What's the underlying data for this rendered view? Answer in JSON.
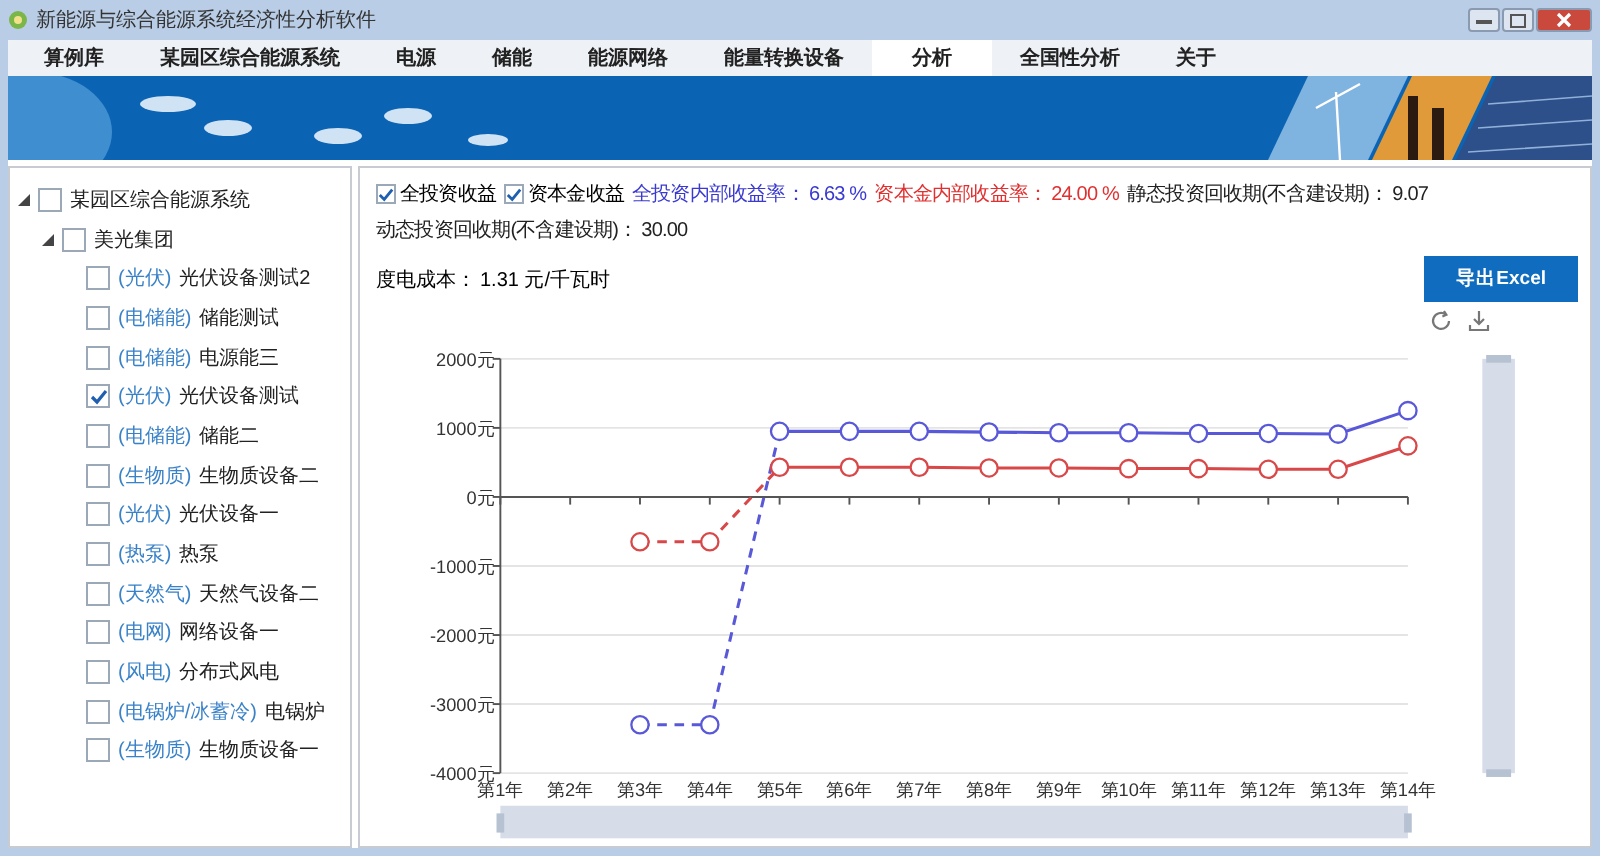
{
  "window": {
    "title": "新能源与综合能源系统经济性分析软件"
  },
  "tabs": [
    {
      "label": "算例库",
      "selected": false
    },
    {
      "label": "某园区综合能源系统",
      "selected": false
    },
    {
      "label": "电源",
      "selected": false
    },
    {
      "label": "储能",
      "selected": false
    },
    {
      "label": "能源网络",
      "selected": false
    },
    {
      "label": "能量转换设备",
      "selected": false
    },
    {
      "label": "分析",
      "selected": true
    },
    {
      "label": "全国性分析",
      "selected": false
    },
    {
      "label": "关于",
      "selected": false
    }
  ],
  "tree": [
    {
      "label": "某园区综合能源系统",
      "checked": false,
      "expanded": true,
      "children": [
        {
          "label": "美光集团",
          "checked": false,
          "expanded": true,
          "children": [
            {
              "tag": "(光伏)",
              "label": "光伏设备测试2",
              "checked": false
            },
            {
              "tag": "(电储能)",
              "label": "储能测试",
              "checked": false
            },
            {
              "tag": "(电储能)",
              "label": "电源能三",
              "checked": false
            },
            {
              "tag": "(光伏)",
              "label": "光伏设备测试",
              "checked": true
            },
            {
              "tag": "(电储能)",
              "label": "储能二",
              "checked": false
            },
            {
              "tag": "(生物质)",
              "label": "生物质设备二",
              "checked": false
            },
            {
              "tag": "(光伏)",
              "label": "光伏设备一",
              "checked": false
            },
            {
              "tag": "(热泵)",
              "label": "热泵",
              "checked": false
            },
            {
              "tag": "(天然气)",
              "label": "天然气设备二",
              "checked": false
            },
            {
              "tag": "(电网)",
              "label": "网络设备一",
              "checked": false
            },
            {
              "tag": "(风电)",
              "label": "分布式风电",
              "checked": false
            },
            {
              "tag": "(电锅炉/冰蓄冷)",
              "label": "电锅炉",
              "checked": false
            },
            {
              "tag": "(生物质)",
              "label": "生物质设备一",
              "checked": false
            }
          ]
        }
      ]
    }
  ],
  "options": [
    {
      "label": "全投资收益",
      "checked": true
    },
    {
      "label": "资本金收益",
      "checked": true
    }
  ],
  "metrics": [
    {
      "label": "全投资内部收益率：",
      "value": "6.63 %",
      "color": "#3a3ad0"
    },
    {
      "label": "资本金内部收益率：",
      "value": "24.00 %",
      "color": "#e03030"
    },
    {
      "label": "静态投资回收期(不含建设期)：",
      "value": "9.07",
      "color": "#222222"
    },
    {
      "label": "动态投资回收期(不含建设期)：",
      "value": "30.00",
      "color": "#222222"
    }
  ],
  "cost": {
    "label": "度电成本：",
    "value": "1.31 元/千瓦时"
  },
  "export_button": "导出Excel",
  "chart_data": {
    "type": "line",
    "grid": true,
    "categories": [
      "第1年",
      "第2年",
      "第3年",
      "第4年",
      "第5年",
      "第6年",
      "第7年",
      "第8年",
      "第9年",
      "第10年",
      "第11年",
      "第12年",
      "第13年",
      "第14年"
    ],
    "ylim": [
      -4000,
      2000
    ],
    "yticks": [
      {
        "value": 2000,
        "label": "2000元"
      },
      {
        "value": 1000,
        "label": "1000元"
      },
      {
        "value": 0,
        "label": "0元"
      },
      {
        "value": -1000,
        "label": "-1000元"
      },
      {
        "value": -2000,
        "label": "-2000元"
      },
      {
        "value": -3000,
        "label": "-3000元"
      },
      {
        "value": -4000,
        "label": "-4000元"
      }
    ],
    "series": [
      {
        "marker": "o",
        "line_style": "dashed",
        "color": "#5858d8",
        "values": [
          null,
          null,
          -3300,
          -3300,
          950,
          950,
          950,
          940,
          930,
          930,
          920,
          920,
          910,
          1250
        ]
      },
      {
        "marker": "o",
        "line_style": "dashed",
        "color": "#d84848",
        "values": [
          null,
          null,
          -650,
          -650,
          430,
          430,
          430,
          420,
          420,
          410,
          410,
          400,
          400,
          740
        ]
      }
    ]
  }
}
